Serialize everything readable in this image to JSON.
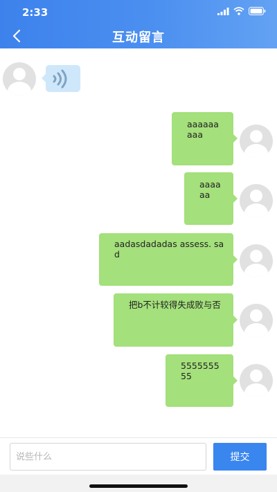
{
  "status_bar": {
    "time": "2:33"
  },
  "header": {
    "title": "互动留言",
    "back_icon": "chevron-left-icon",
    "background_gradient": [
      "#3d82ec",
      "#63a2f3"
    ]
  },
  "chat": {
    "incoming_voice": {
      "icon": "voice-wave-icon",
      "bubble_color": "#cfe7fa"
    },
    "outgoing_bubble_color": "#a4e07b",
    "messages": [
      {
        "text": "aaaaaaaaa"
      },
      {
        "text": "aaaaaa"
      },
      {
        "text": "aadasdadadas assess. sad"
      },
      {
        "text": "把b不计较得失成败与否"
      },
      {
        "text": "555555555"
      }
    ]
  },
  "input_bar": {
    "placeholder": "说些什么",
    "submit_label": "提交",
    "submit_color": "#3a86ef"
  }
}
